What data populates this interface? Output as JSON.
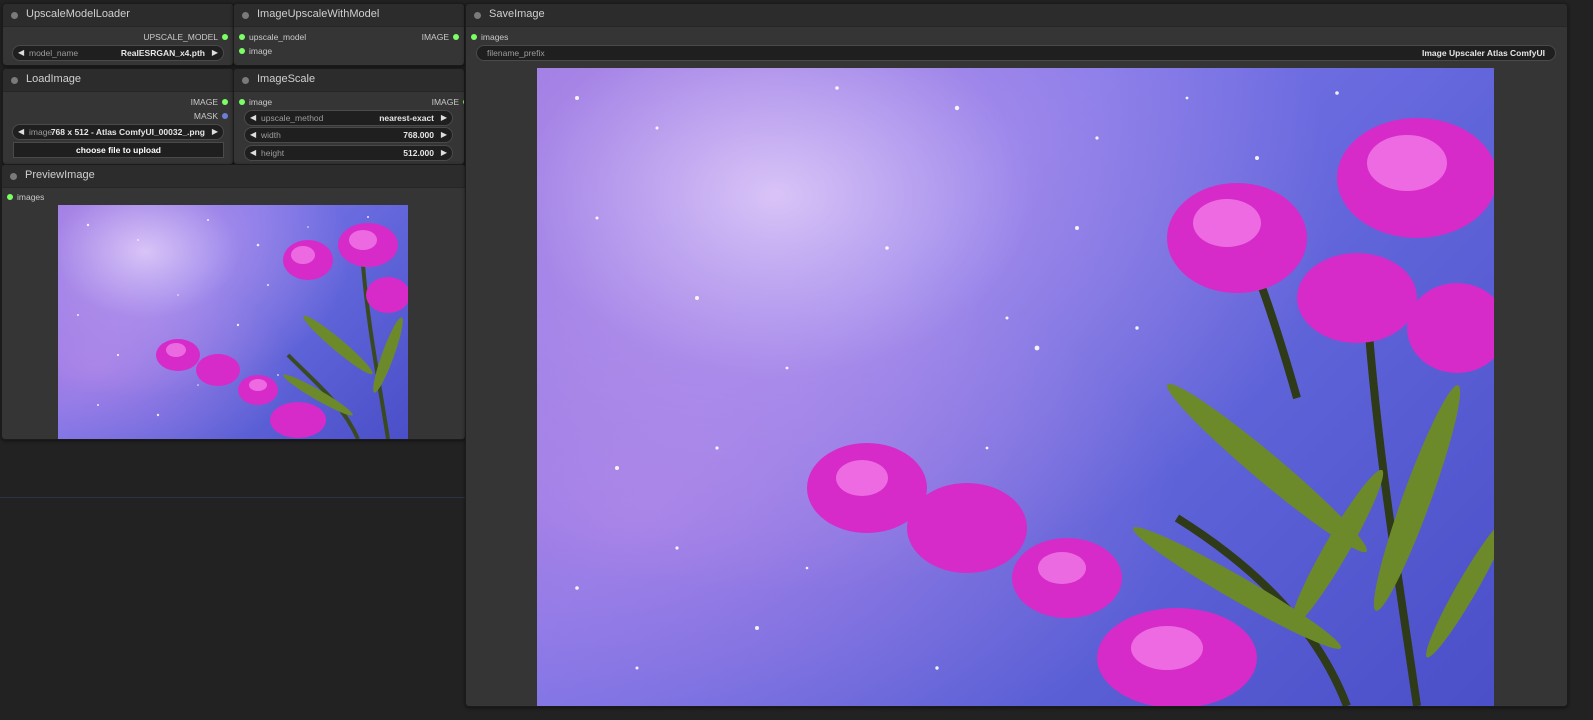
{
  "colors": {
    "canvas": "#222222",
    "node_bg": "#353535",
    "slot_pin": "#7cff64",
    "mask_pin": "#6b7fd6"
  },
  "nodes": {
    "upscale_model_loader": {
      "title": "UpscaleModelLoader",
      "output": "UPSCALE_MODEL",
      "widget": {
        "name": "model_name",
        "value": "RealESRGAN_x4.pth"
      }
    },
    "image_upscale_with_model": {
      "title": "ImageUpscaleWithModel",
      "inputs": [
        "upscale_model",
        "image"
      ],
      "output": "IMAGE"
    },
    "save_image": {
      "title": "SaveImage",
      "input": "images",
      "widget": {
        "name": "filename_prefix",
        "value": "Image Upscaler Atlas ComfyUI"
      },
      "image_icon": "upscaled-flower-galaxy-image"
    },
    "load_image": {
      "title": "LoadImage",
      "outputs": [
        "IMAGE",
        "MASK"
      ],
      "widget": {
        "name": "image",
        "value": "768 x 512 - Atlas ComfyUI_00032_.png"
      },
      "upload_button": "choose file to upload"
    },
    "image_scale": {
      "title": "ImageScale",
      "input": "image",
      "output": "IMAGE",
      "widgets": [
        {
          "name": "upscale_method",
          "value": "nearest-exact"
        },
        {
          "name": "width",
          "value": "768.000"
        },
        {
          "name": "height",
          "value": "512.000"
        }
      ]
    },
    "preview_image": {
      "title": "PreviewImage",
      "input": "images",
      "image_icon": "preview-flower-galaxy-image"
    }
  }
}
